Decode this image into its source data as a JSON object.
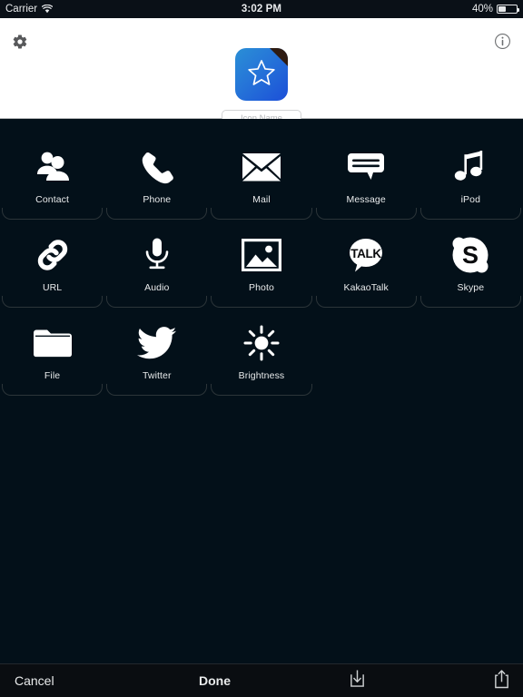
{
  "statusbar": {
    "carrier": "Carrier",
    "wifi_icon": "wifi-icon",
    "time": "3:02 PM",
    "battery_percent": "40%",
    "battery_level": 40,
    "battery_icon": "battery-icon"
  },
  "header": {
    "settings_icon": "gear-icon",
    "info_icon": "info-circle-icon",
    "app_icon": {
      "name": "star-app-icon",
      "glyph": "star-outline-icon",
      "gradient_start": "#2a8fd6",
      "gradient_end": "#1c4fd8",
      "fold_color": "#2e1b12"
    },
    "name_input": {
      "placeholder": "Icon Name",
      "value": ""
    }
  },
  "grid": {
    "background": "#031019",
    "items": [
      {
        "label": "Contact",
        "icon": "contacts-icon"
      },
      {
        "label": "Phone",
        "icon": "phone-handset-icon"
      },
      {
        "label": "Mail",
        "icon": "envelope-icon"
      },
      {
        "label": "Message",
        "icon": "speech-bubble-icon"
      },
      {
        "label": "iPod",
        "icon": "music-note-icon"
      },
      {
        "label": "URL",
        "icon": "link-chain-icon"
      },
      {
        "label": "Audio",
        "icon": "microphone-icon"
      },
      {
        "label": "Photo",
        "icon": "photo-frame-icon"
      },
      {
        "label": "KakaoTalk",
        "icon": "kakaotalk-icon"
      },
      {
        "label": "Skype",
        "icon": "skype-icon"
      },
      {
        "label": "File",
        "icon": "folder-icon"
      },
      {
        "label": "Twitter",
        "icon": "twitter-bird-icon"
      },
      {
        "label": "Brightness",
        "icon": "sun-icon"
      }
    ]
  },
  "toolbar": {
    "cancel_label": "Cancel",
    "done_label": "Done",
    "import_icon": "download-tray-icon",
    "share_icon": "share-up-arrow-icon"
  }
}
